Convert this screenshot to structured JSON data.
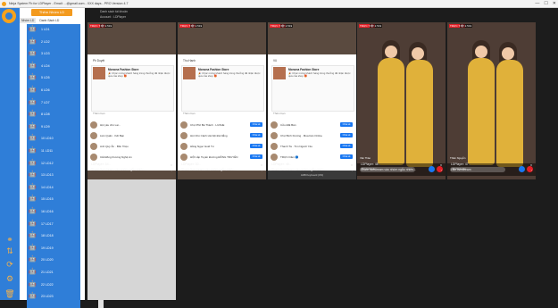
{
  "window": {
    "title": "Ninja System Fb for LDPlayer - Email: ...@gmail.com - XXX days - PRO Version 4.7",
    "minimize": "—",
    "maximize": "☐",
    "close": "✕"
  },
  "panel": {
    "header": "Thêm Nhóm LD",
    "tabs": [
      "Nhóm LD",
      "Danh Sách LD"
    ]
  },
  "devices": [
    "1 LD1",
    "2 LD2",
    "3 LD3",
    "4 LD4",
    "5 LD5",
    "6 LD6",
    "7 LD7",
    "8 LD8",
    "9 LD9",
    "10 LD10",
    "11 LD11",
    "12 LD12",
    "13 LD13",
    "14 LD14",
    "15 LD15",
    "16 LD16",
    "17 LD17",
    "18 LD18",
    "19 LD19",
    "20 LD20",
    "21 LD21",
    "22 LD22",
    "23 LD23"
  ],
  "info": {
    "line1": "Danh sách tài khoản",
    "line2": "Account : LDPlayer"
  },
  "cards": [
    {
      "live": "TRỰC TIẾP",
      "views": "👁 2.519",
      "type": "share",
      "who": "Ph Duyệt",
      "share_name": "Monona Fashion Store",
      "share_desc": "🎉 Chúc mừng khách hàng trúng thưởng đã nhận được quà của shop 🎁",
      "placeholder": "Thêm bạn",
      "rows": [
        {
          "name": "Hội yêu chó Lai...",
          "btn": ""
        },
        {
          "name": "Liên Quân · Kết Bạn",
          "btn": ""
        },
        {
          "name": "Anh Quỳ Ân · Bốn Triệu",
          "btn": ""
        },
        {
          "name": "Cắt Đồng thương Nghệ An",
          "btn": ""
        }
      ],
      "kbd": "",
      "caption1": "LDPlayer: 54 -",
      "caption2": "Share livestream vào nhóm ngẫu nhiên..."
    },
    {
      "live": "TRỰC TIẾP",
      "views": "👁 2.519",
      "type": "share",
      "who": "Thu Hạnh",
      "share_name": "Monona Fashion Store",
      "share_desc": "🎉 Chúc mừng khách hàng trúng thưởng đã nhận được quà của shop 🎁",
      "placeholder": "Thêm bạn",
      "rows": [
        {
          "name": "Chợ Phố Bá Thành · LUXHE",
          "btn": "Chia sẻ"
        },
        {
          "name": "Hội Chó Cảnh Hà Nội Đà Nẵng",
          "btn": "Chia sẻ"
        },
        {
          "name": "Hằng Ngọc Guid Tư",
          "btn": "Chia sẻ"
        },
        {
          "name": "HỘI Lắp Tuyển Đường ĐÔNG TRUYỀN",
          "btn": "Chia sẻ"
        }
      ],
      "kbd": "",
      "caption1": "LDPlayer: 50 -",
      "caption2": "Share livestream vào nhóm ngẫu nhiên..."
    },
    {
      "live": "TRỰC TIẾP",
      "views": "👁 2.519",
      "type": "share",
      "who": "Vũ",
      "share_name": "Monona Fashion Store",
      "share_desc": "🎉 Chúc mừng khách hàng trúng thưởng đã nhận được quà của shop 🎁",
      "placeholder": "Thêm bạn",
      "rows": [
        {
          "name": "Cửu Đất Bán",
          "btn": "Chia sẻ"
        },
        {
          "name": "Chợ Bình Dương · Mua bán Online",
          "btn": "Chia sẻ"
        },
        {
          "name": "Thanh Tà · Tìm Người Yêu",
          "btn": "Chia sẻ"
        },
        {
          "name": "TRỰC Dâm 🔵",
          "btn": "Chia sẻ"
        }
      ],
      "kbd": "ADB Keyboard (ON)",
      "caption1": "LDPlayer: 48 -",
      "caption2": "Share livestream vào nhóm ngẫu nhiên..."
    },
    {
      "live": "TRỰC TIẾP",
      "views": "👁 2.519",
      "type": "live",
      "comment1": "Vân Thảo",
      "comment2": "Viết bình luận",
      "caption1": "LDPlayer: 48 -",
      "caption2": "Share livestream vào nhóm ngẫu nhiên..."
    },
    {
      "live": "TRỰC TIẾP",
      "views": "👁 2.519",
      "type": "live",
      "comment1": "Thiên Nguyễn",
      "comment2": "Viết bình luận",
      "caption1": "LDPlayer: 47 -",
      "caption2": "Like livestream"
    }
  ]
}
